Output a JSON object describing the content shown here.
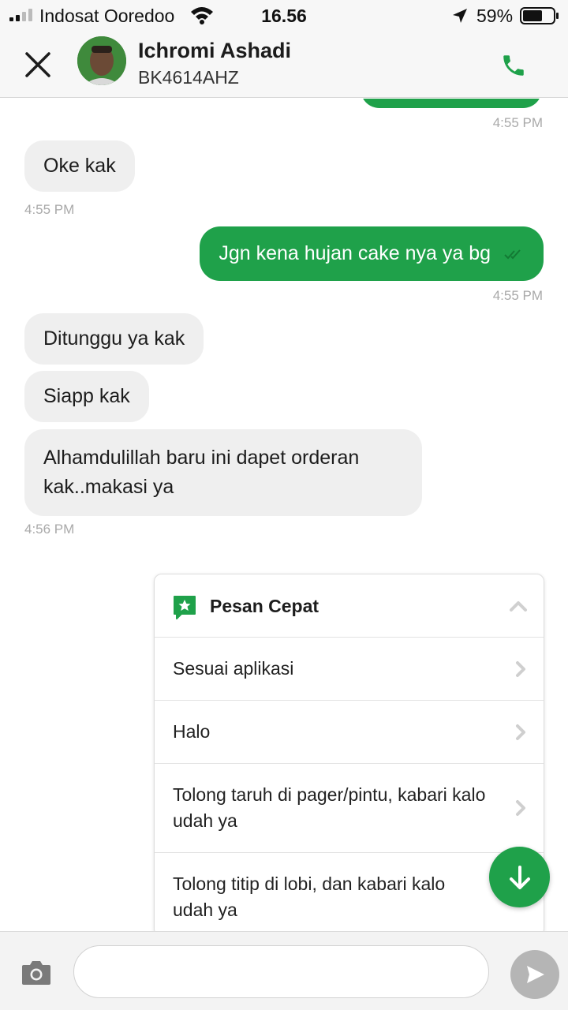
{
  "status_bar": {
    "carrier": "Indosat Ooredoo",
    "time": "16.56",
    "battery": "59%",
    "icons": [
      "signal-icon",
      "wifi-icon",
      "location-arrow-icon",
      "battery-icon"
    ]
  },
  "header": {
    "name": "Ichromi Ashadi",
    "plate": "BK4614AHZ",
    "icons": [
      "close-icon",
      "avatar",
      "phone-icon"
    ],
    "accent_color": "#1fa14a"
  },
  "messages": [
    {
      "direction": "outgoing",
      "text": "",
      "time": "4:55 PM"
    },
    {
      "direction": "incoming",
      "text": "Oke kak",
      "time": "4:55 PM"
    },
    {
      "direction": "outgoing",
      "text": "Jgn kena hujan cake nya ya bg",
      "time": "4:55 PM"
    },
    {
      "direction": "incoming",
      "text": "Ditunggu ya kak"
    },
    {
      "direction": "incoming",
      "text": "Siapp kak"
    },
    {
      "direction": "incoming",
      "text": "Alhamdulillah baru ini dapet orderan kak..makasi ya",
      "time": "4:56 PM"
    }
  ],
  "quick_reply": {
    "title": "Pesan Cepat",
    "icon": "star-chat-icon",
    "items": [
      {
        "label": "Sesuai aplikasi"
      },
      {
        "label": "Halo"
      },
      {
        "label": "Tolong taruh di pager/pintu, kabari kalo udah ya"
      },
      {
        "label": "Tolong titip di lobi, dan kabari kalo udah ya"
      }
    ]
  },
  "composer": {
    "placeholder": "",
    "icons": [
      "camera-icon",
      "send-icon",
      "scroll-down-icon"
    ]
  },
  "colors": {
    "outgoing_bubble": "#1fa14a",
    "incoming_bubble": "#efefef",
    "send_disabled": "#b5b5b5"
  }
}
